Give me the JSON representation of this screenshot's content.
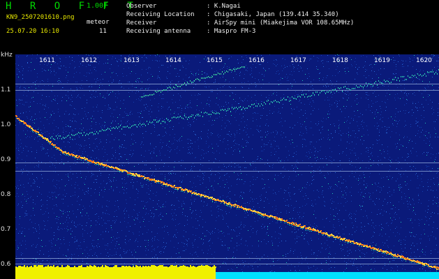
{
  "header": {
    "brand": "H R O F F T",
    "version": "1.00f",
    "filename": "KN9_2507201610.png",
    "meteor_label": "meteor",
    "datetime": "25.07.20 16:10",
    "meteor_count": "11",
    "info": [
      {
        "label": "Observer",
        "value": ": K.Nagai"
      },
      {
        "label": "Receiving Location",
        "value": ": Chigasaki, Japan (139.414 35.340)"
      },
      {
        "label": "Receiver",
        "value": ": AirSpy mini (Miakejima VOR 108.65MHz)"
      },
      {
        "label": "Receiving antenna",
        "value": ": Maspro FM-3"
      }
    ]
  },
  "spectrogram": {
    "y_unit": "kHz",
    "y_ticks": [
      "1.1",
      "1.0",
      "0.9",
      "0.8",
      "0.7",
      "0.6"
    ],
    "x_ticks": [
      "1611",
      "1612",
      "1613",
      "1614",
      "1615",
      "1616",
      "1617",
      "1618",
      "1619",
      "1620"
    ],
    "colors": {
      "background": "#0a1a7a",
      "noise": "#2a6ad8",
      "trace": "#ff7a1a",
      "signal_bar": "#f0f000",
      "signal_bar_right": "#00e0ff",
      "ref_line": "#c8e6ff"
    }
  }
}
